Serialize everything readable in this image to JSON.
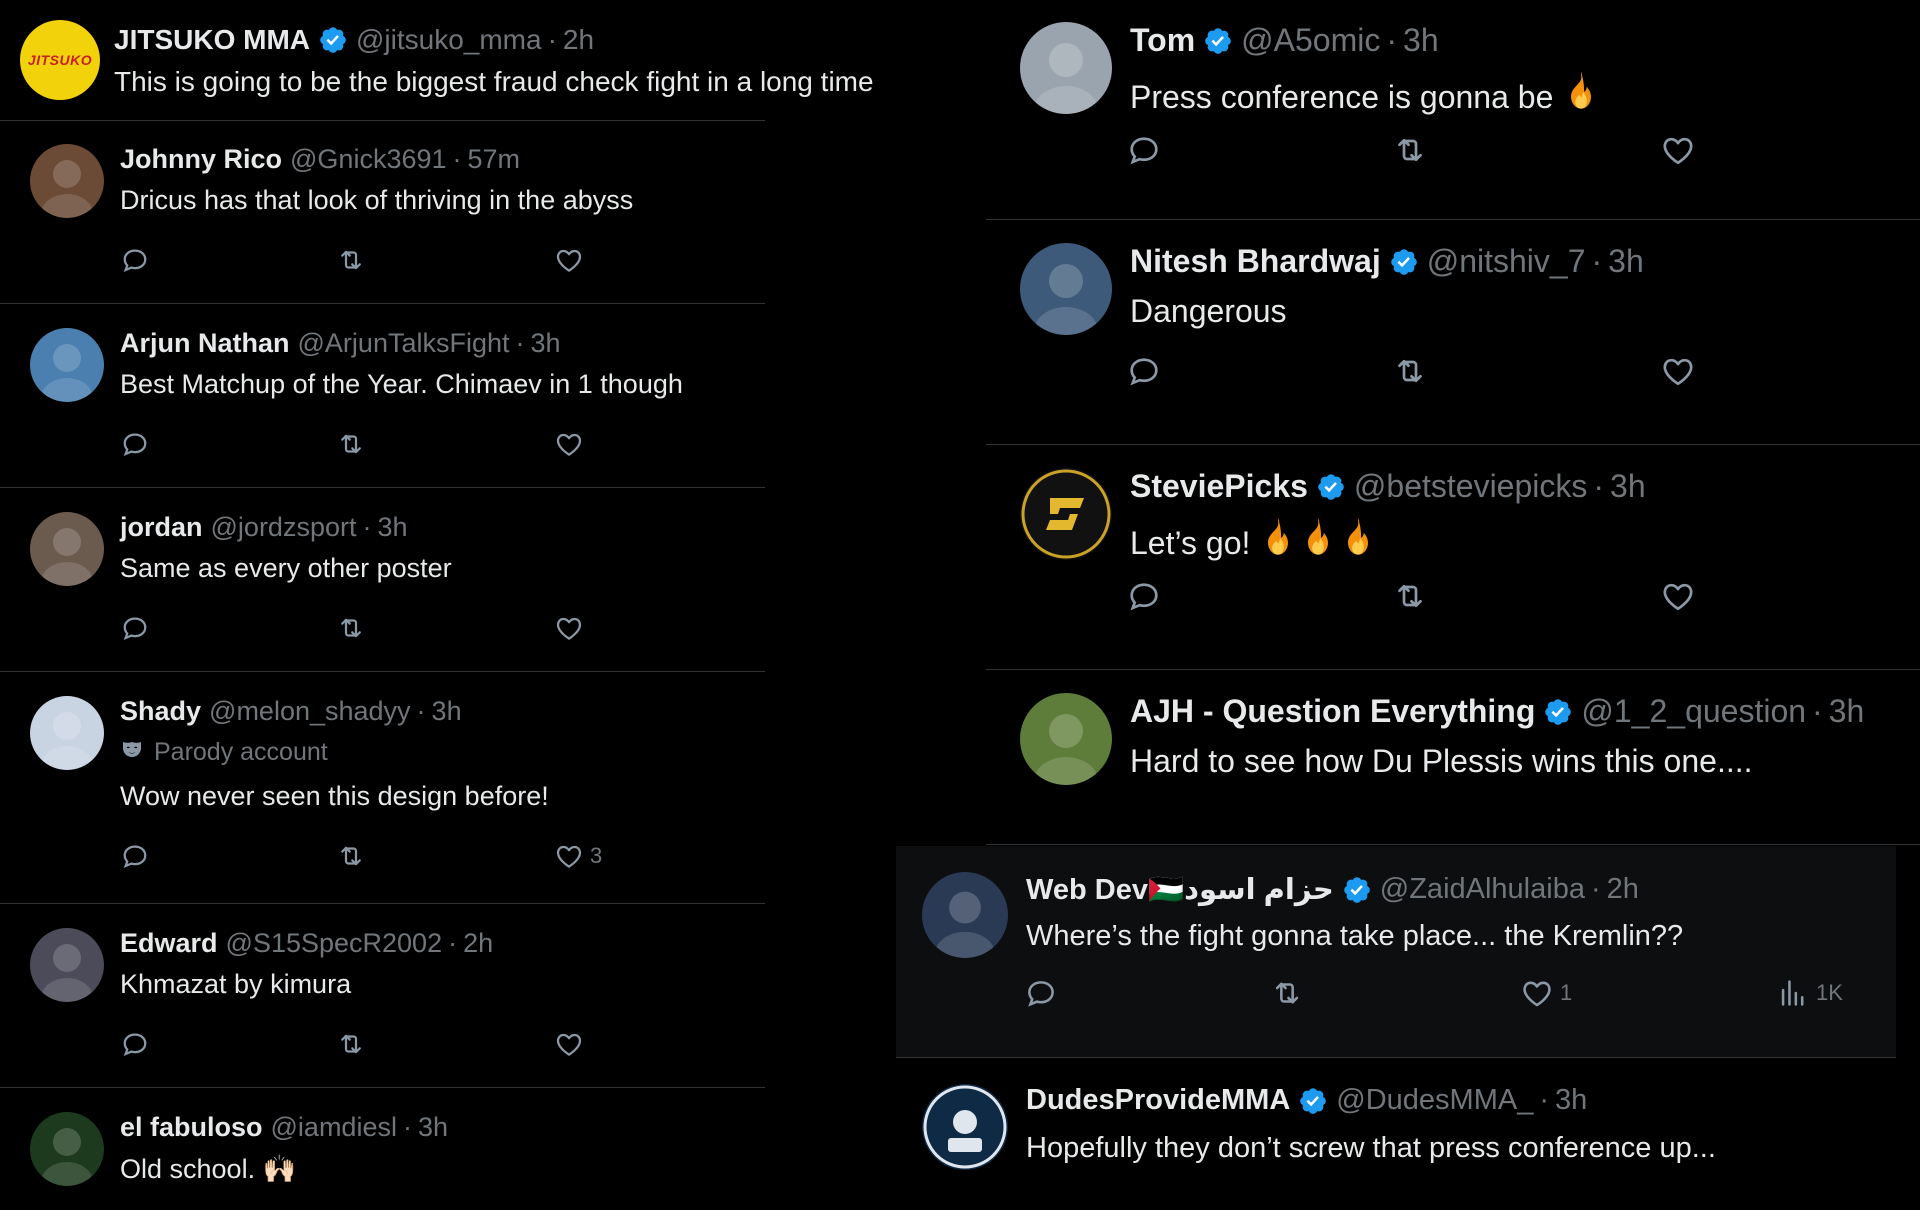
{
  "colors": {
    "verified": "#1d9bf0",
    "muted": "#71767b",
    "text": "#e7e9ea",
    "divider": "#2f3336"
  },
  "left": {
    "main_post": {
      "avatar_text": "JITSUKO",
      "name": "JITSUKO MMA",
      "handle": "@jitsuko_mma",
      "time": "2h",
      "text": "This is going to be the biggest fraud check fight in a long time"
    },
    "replies": [
      {
        "name": "Johnny Rico",
        "handle": "@Gnick3691",
        "time": "57m",
        "text": "Dricus has that look of thriving in the abyss"
      },
      {
        "name": "Arjun Nathan",
        "handle": "@ArjunTalksFight",
        "time": "3h",
        "text": "Best Matchup of the Year. Chimaev in 1 though"
      },
      {
        "name": "jordan",
        "handle": "@jordzsport",
        "time": "3h",
        "text": "Same as every other poster"
      },
      {
        "name": "Shady",
        "handle": "@melon_shadyy",
        "time": "3h",
        "label": "Parody account",
        "text": "Wow never seen this design before!",
        "likes": "3"
      },
      {
        "name": "Edward",
        "handle": "@S15SpecR2002",
        "time": "2h",
        "text": "Khmazat by kimura"
      },
      {
        "name": "el fabuloso",
        "handle": "@iamdiesl",
        "time": "3h",
        "text": "Old school. 🙌🏻"
      }
    ]
  },
  "right": {
    "replies": [
      {
        "name": "Tom",
        "handle": "@A5omic",
        "time": "3h",
        "text": "Press conference is gonna be"
      },
      {
        "name": "Nitesh Bhardwaj",
        "handle": "@nitshiv_7",
        "time": "3h",
        "text": "Dangerous"
      },
      {
        "name": "SteviePicks",
        "handle": "@betsteviepicks",
        "time": "3h",
        "text": "Let’s go!"
      },
      {
        "name": "AJH - Question Everything",
        "handle": "@1_2_question",
        "time": "3h",
        "text": "Hard to see how Du Plessis wins this one...."
      },
      {
        "name": "Web Dev🇵🇸حزام اسود",
        "handle": "@ZaidAlhulaiba",
        "time": "2h",
        "text": "Where’s the fight gonna take place... the Kremlin??",
        "likes": "1",
        "views": "1K"
      },
      {
        "name": "DudesProvideMMA",
        "handle": "@DudesMMA_",
        "time": "3h",
        "text": "Hopefully they don’t screw that press conference up..."
      }
    ]
  }
}
